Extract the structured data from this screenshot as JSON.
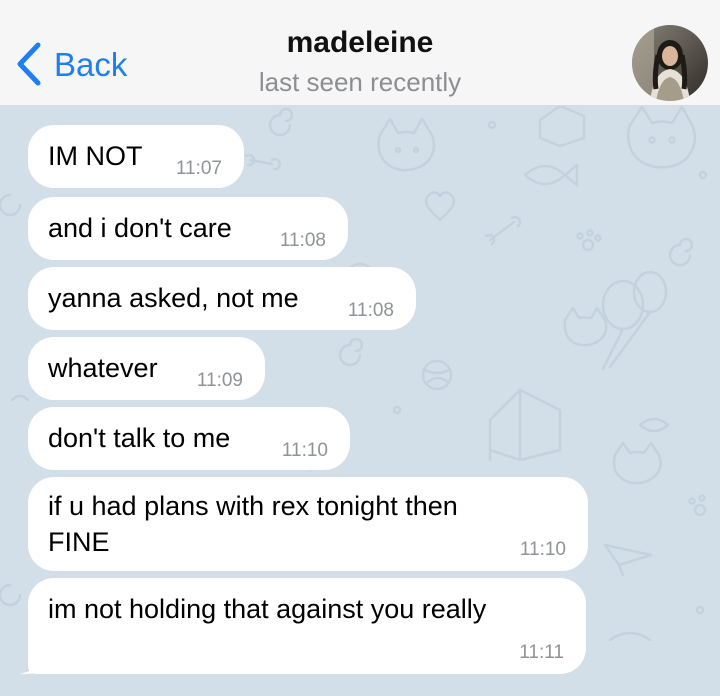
{
  "header": {
    "back_label": "Back",
    "name": "madeleine",
    "status": "last seen recently"
  },
  "messages": [
    {
      "text": "IM NOT",
      "time": "11:07"
    },
    {
      "text": "and i don't care",
      "time": "11:08"
    },
    {
      "text": "yanna asked, not me",
      "time": "11:08"
    },
    {
      "text": "whatever",
      "time": "11:09"
    },
    {
      "text": "don't talk to me",
      "time": "11:10"
    },
    {
      "text_line1": "if u had plans with rex tonight then",
      "text_line2": "FINE",
      "time": "11:10"
    },
    {
      "text": "im not holding that against you really",
      "time": "11:11"
    }
  ],
  "colors": {
    "accent": "#1d7ff0",
    "chat_background": "#d3dfe8",
    "bubble": "#ffffff",
    "header": "#f6f6f7"
  },
  "icons": {
    "back": "chevron-left-icon",
    "avatar": "profile-photo"
  }
}
